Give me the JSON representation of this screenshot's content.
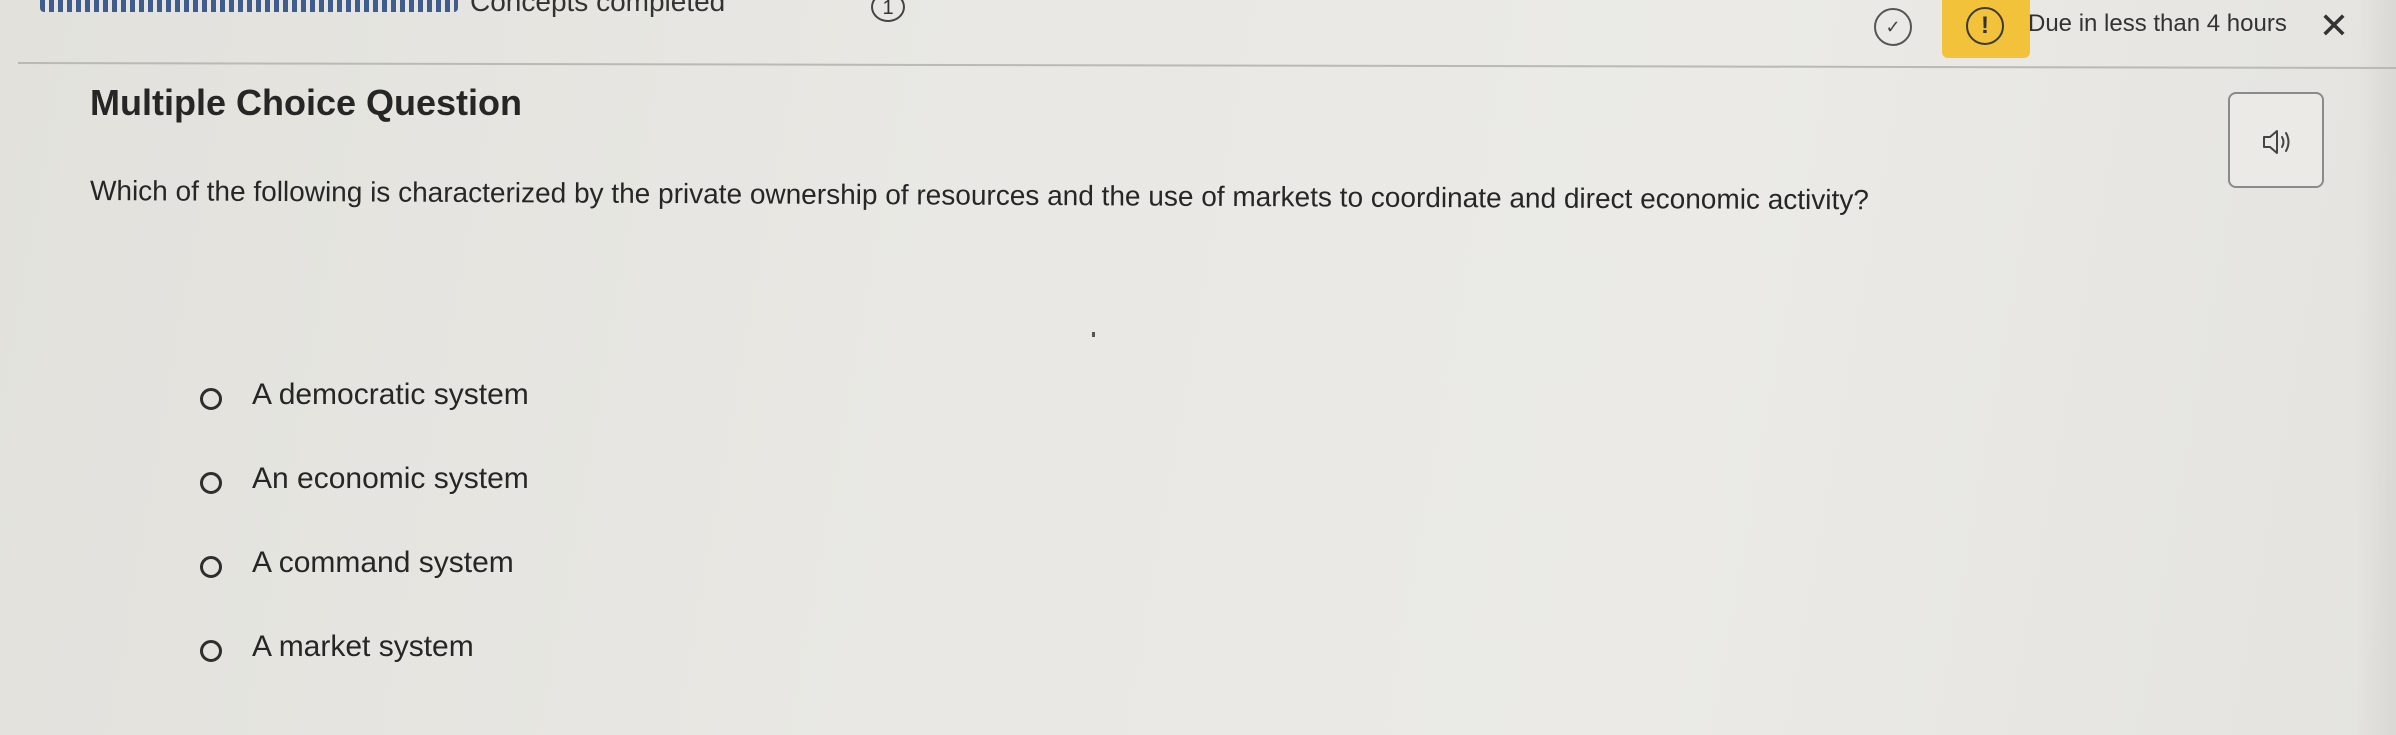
{
  "header": {
    "concepts_label": "Concepts completed",
    "concepts_count": "1",
    "due_text": "Due in less than 4 hours",
    "due_icon": "!",
    "check_icon": "✓",
    "close_icon": "✕"
  },
  "question": {
    "type_label": "Multiple Choice Question",
    "text": "Which of the following is characterized by the private ownership of resources and the use of markets to coordinate and direct economic activity?",
    "options": [
      {
        "label": "A democratic system"
      },
      {
        "label": "An economic system"
      },
      {
        "label": "A command system"
      },
      {
        "label": "A market system"
      }
    ]
  },
  "icons": {
    "audio": "speaker-icon",
    "check": "check-circle-icon",
    "alert": "alert-icon",
    "close": "close-icon",
    "radio": "radio-button-icon"
  },
  "colors": {
    "due_badge": "#f2c23a",
    "progress": "#3f5d8c",
    "background": "#e6e5e1"
  }
}
